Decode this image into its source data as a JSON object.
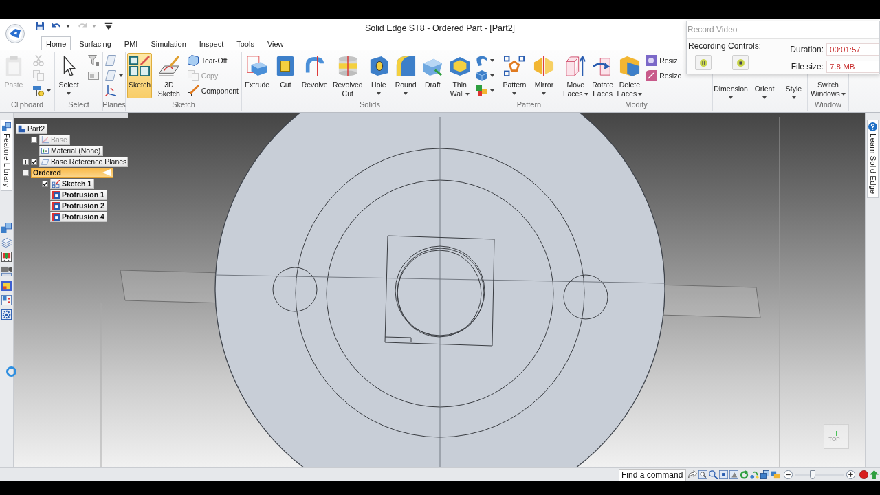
{
  "title_bar": {
    "title": "Solid Edge ST8 - Ordered Part - [Part2]",
    "quick_access": [
      {
        "disabled": false,
        "dropdown": false
      },
      {
        "disabled": false,
        "dropdown": true
      },
      {
        "disabled": true,
        "dropdown": true
      },
      {
        "disabled": false,
        "dropdown": false
      }
    ]
  },
  "tabs": [
    {
      "label": "Home",
      "selected": true
    },
    {
      "label": "Surfacing",
      "selected": false
    },
    {
      "label": "PMI",
      "selected": false
    },
    {
      "label": "Simulation",
      "selected": false
    },
    {
      "label": "Inspect",
      "selected": false
    },
    {
      "label": "Tools",
      "selected": false
    },
    {
      "label": "View",
      "selected": false
    }
  ],
  "ribbon": {
    "groups": [
      {
        "label": "Clipboard",
        "buttons": [
          {
            "kind": "large",
            "lines": [
              "Paste"
            ],
            "dropdown": false,
            "disabled": true,
            "selected": false
          },
          {
            "kind": "icon",
            "dropdown": false,
            "disabled": true,
            "selected": false
          },
          {
            "kind": "icon",
            "dropdown": false,
            "disabled": true,
            "selected": false
          },
          {
            "kind": "icon",
            "dropdown": true,
            "disabled": false,
            "selected": false
          }
        ]
      },
      {
        "label": "Select",
        "buttons": [
          {
            "kind": "large",
            "lines": [
              "Select"
            ],
            "dropdown": true,
            "disabled": false,
            "selected": false
          },
          {
            "kind": "icon",
            "dropdown": false,
            "disabled": false,
            "selected": false
          },
          {
            "kind": "icon",
            "dropdown": false,
            "disabled": false,
            "selected": false
          }
        ]
      },
      {
        "label": "Planes",
        "buttons": [
          {
            "kind": "icon",
            "dropdown": false,
            "disabled": false,
            "selected": false
          },
          {
            "kind": "icon",
            "dropdown": true,
            "disabled": false,
            "selected": false
          },
          {
            "kind": "icon",
            "dropdown": false,
            "disabled": false,
            "selected": false
          }
        ]
      },
      {
        "label": "Sketch",
        "buttons": [
          {
            "kind": "large",
            "lines": [
              "Sketch"
            ],
            "dropdown": false,
            "disabled": false,
            "selected": true
          },
          {
            "kind": "large",
            "lines": [
              "3D",
              "Sketch"
            ],
            "dropdown": false,
            "disabled": false,
            "selected": false
          },
          {
            "kind": "small",
            "lines": [
              "Tear-Off"
            ],
            "dropdown": false,
            "disabled": false,
            "selected": false
          },
          {
            "kind": "small",
            "lines": [
              "Copy"
            ],
            "dropdown": false,
            "disabled": true,
            "selected": false
          },
          {
            "kind": "small",
            "lines": [
              "Component"
            ],
            "dropdown": false,
            "disabled": false,
            "selected": false
          }
        ]
      },
      {
        "label": "Solids",
        "buttons": [
          {
            "kind": "large",
            "lines": [
              "Extrude"
            ],
            "dropdown": false,
            "disabled": false,
            "selected": false
          },
          {
            "kind": "large",
            "lines": [
              "Cut"
            ],
            "dropdown": false,
            "disabled": false,
            "selected": false
          },
          {
            "kind": "large",
            "lines": [
              "Revolve"
            ],
            "dropdown": false,
            "disabled": false,
            "selected": false
          },
          {
            "kind": "large",
            "lines": [
              "Revolved",
              "Cut"
            ],
            "dropdown": false,
            "disabled": false,
            "selected": false
          },
          {
            "kind": "large",
            "lines": [
              "Hole"
            ],
            "dropdown": true,
            "disabled": false,
            "selected": false
          },
          {
            "kind": "large",
            "lines": [
              "Round"
            ],
            "dropdown": true,
            "disabled": false,
            "selected": false
          },
          {
            "kind": "large",
            "lines": [
              "Draft"
            ],
            "dropdown": false,
            "disabled": false,
            "selected": false
          },
          {
            "kind": "large",
            "lines": [
              "Thin",
              "Wall"
            ],
            "dropdown": true,
            "disabled": false,
            "selected": false
          },
          {
            "kind": "icon",
            "dropdown": true,
            "disabled": false,
            "selected": false
          },
          {
            "kind": "icon",
            "dropdown": true,
            "disabled": false,
            "selected": false
          },
          {
            "kind": "icon",
            "dropdown": true,
            "disabled": false,
            "selected": false
          }
        ]
      },
      {
        "label": "Pattern",
        "buttons": [
          {
            "kind": "large",
            "lines": [
              "Pattern"
            ],
            "dropdown": true,
            "disabled": false,
            "selected": false
          },
          {
            "kind": "large",
            "lines": [
              "Mirror"
            ],
            "dropdown": true,
            "disabled": false,
            "selected": false
          }
        ]
      },
      {
        "label": "Modify",
        "buttons": [
          {
            "kind": "large",
            "lines": [
              "Move",
              "Faces"
            ],
            "dropdown": true,
            "disabled": false,
            "selected": false
          },
          {
            "kind": "large",
            "lines": [
              "Rotate",
              "Faces"
            ],
            "dropdown": false,
            "disabled": false,
            "selected": false
          },
          {
            "kind": "large",
            "lines": [
              "Delete",
              "Faces"
            ],
            "dropdown": true,
            "disabled": false,
            "selected": false
          },
          {
            "kind": "small",
            "lines": [
              "Resiz"
            ],
            "dropdown": false,
            "disabled": false,
            "selected": false
          },
          {
            "kind": "small",
            "lines": [
              "Resize"
            ],
            "dropdown": false,
            "disabled": false,
            "selected": false
          }
        ]
      },
      {
        "buttons": [
          {
            "kind": "collapsed",
            "lines": [
              "Dimension"
            ],
            "dropdown": true,
            "disabled": false,
            "selected": false
          }
        ]
      },
      {
        "buttons": [
          {
            "kind": "collapsed",
            "lines": [
              "Orient"
            ],
            "dropdown": true,
            "disabled": false,
            "selected": false
          }
        ]
      },
      {
        "buttons": [
          {
            "kind": "collapsed",
            "lines": [
              "Style"
            ],
            "dropdown": true,
            "disabled": false,
            "selected": false
          }
        ]
      },
      {
        "label": "Window",
        "buttons": [
          {
            "kind": "collapsed",
            "lines": [
              "Switch",
              "Windows"
            ],
            "dropdown": true,
            "disabled": false,
            "selected": false
          }
        ]
      }
    ]
  },
  "left_panel": {
    "tab": "Feature Library"
  },
  "feature_tree": {
    "items": [
      {
        "kind": "part",
        "label": "Part2",
        "selected": false,
        "disabled": false,
        "children": [
          {
            "kind": "coordinate-system",
            "label": "Base",
            "checked": false,
            "selected": false,
            "disabled": true
          },
          {
            "kind": "material",
            "label": "Material (None)",
            "selected": false,
            "disabled": false
          },
          {
            "kind": "planes",
            "label": "Base Reference Planes",
            "checked": true,
            "expanded": false,
            "selected": false,
            "disabled": false
          },
          {
            "kind": "group",
            "label": "Ordered",
            "expanded": true,
            "selected": true,
            "disabled": false,
            "children": [
              {
                "kind": "sketch",
                "label": "Sketch 1",
                "checked": true,
                "selected": false,
                "disabled": false
              },
              {
                "kind": "protrusion",
                "label": "Protrusion 1",
                "selected": false,
                "disabled": false
              },
              {
                "kind": "protrusion",
                "label": "Protrusion 2",
                "selected": false,
                "disabled": false
              },
              {
                "kind": "protrusion",
                "label": "Protrusion 4",
                "selected": false,
                "disabled": false
              }
            ]
          }
        ]
      }
    ]
  },
  "viewport": {
    "view_cube": {
      "label": "TOP"
    }
  },
  "right_panel": {
    "tab": "Learn Solid Edge"
  },
  "status_bar": {
    "search": {
      "placeholder": "Find a command"
    },
    "zoom": {
      "level": 0.36
    }
  },
  "record_dialog": {
    "title": "Record Video",
    "controls_label": "Recording Controls:",
    "fields": [
      {
        "label": "Duration:",
        "value": "00:01:57"
      },
      {
        "label": "File size:",
        "value": "7.8 MB"
      }
    ]
  }
}
